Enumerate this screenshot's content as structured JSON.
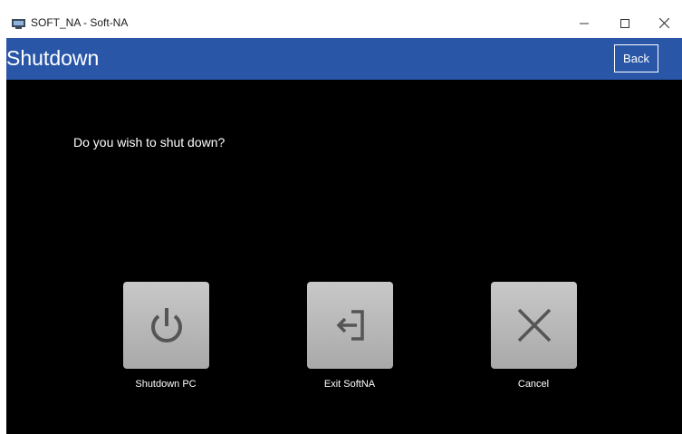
{
  "window": {
    "title": "SOFT_NA - Soft-NA"
  },
  "header": {
    "title": "Shutdown",
    "back_label": "Back"
  },
  "dialog": {
    "question": "Do you wish to shut down?"
  },
  "actions": [
    {
      "label": "Shutdown PC",
      "icon": "power-icon"
    },
    {
      "label": "Exit SoftNA",
      "icon": "exit-icon"
    },
    {
      "label": "Cancel",
      "icon": "close-icon"
    }
  ],
  "colors": {
    "header_bg": "#2a56a8",
    "content_bg": "#000000",
    "tile_bg": "#b9b9b9",
    "icon_color": "#555555"
  }
}
